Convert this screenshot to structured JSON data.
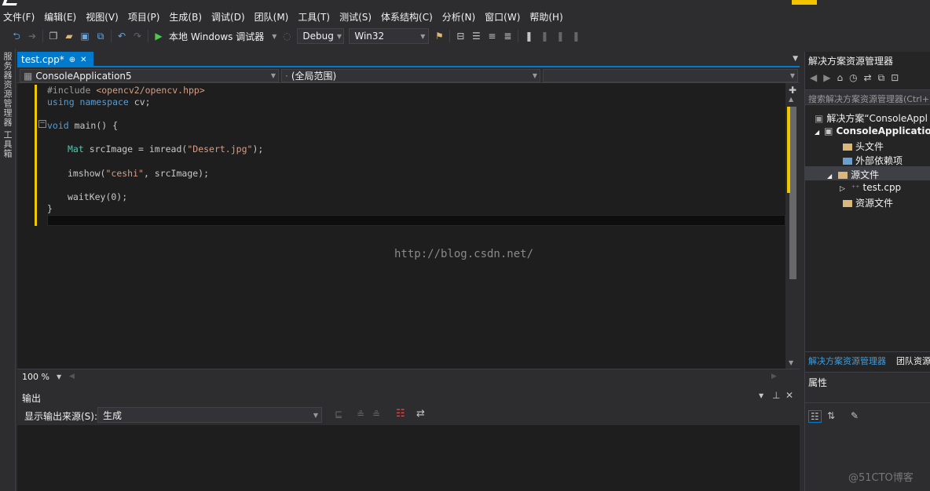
{
  "menu": [
    "文件(F)",
    "编辑(E)",
    "视图(V)",
    "项目(P)",
    "生成(B)",
    "调试(D)",
    "团队(M)",
    "工具(T)",
    "测试(S)",
    "体系结构(C)",
    "分析(N)",
    "窗口(W)",
    "帮助(H)"
  ],
  "toolbar": {
    "run_label": "本地 Windows 调试器",
    "config": "Debug",
    "platform": "Win32"
  },
  "leftstrip": {
    "server_explorer": "服务器资源管理器",
    "toolbox": "工具箱"
  },
  "editor": {
    "tab_label": "test.cpp*",
    "tab_pin": "⊕",
    "tab_close": "✕",
    "project_combo": "ConsoleApplication5",
    "scope_combo": "(全局范围)",
    "lines": [
      "#include <opencv2/opencv.hpp>",
      "using namespace cv;",
      "void main() {",
      "Mat srcImage = imread(\"Desert.jpg\");",
      "imshow(\"ceshi\", srcImage);",
      "waitKey(0);",
      "}"
    ],
    "watermark": "http://blog.csdn.net/",
    "zoom": "100 %"
  },
  "output": {
    "title": "输出",
    "source_label": "显示输出来源(S):",
    "source_value": "生成"
  },
  "solution": {
    "title": "解决方案资源管理器",
    "search_placeholder": "搜索解决方案资源管理器(Ctrl+",
    "solution_node": "解决方案“ConsoleAppl",
    "project_node": "ConsoleApplication",
    "headers": "头文件",
    "external": "外部依赖项",
    "sources": "源文件",
    "testcpp": "test.cpp",
    "resources": "资源文件",
    "tab_solution": "解决方案资源管理器",
    "tab_team": "团队资源",
    "properties": "属性"
  },
  "watermark2": "@51CTO博客"
}
